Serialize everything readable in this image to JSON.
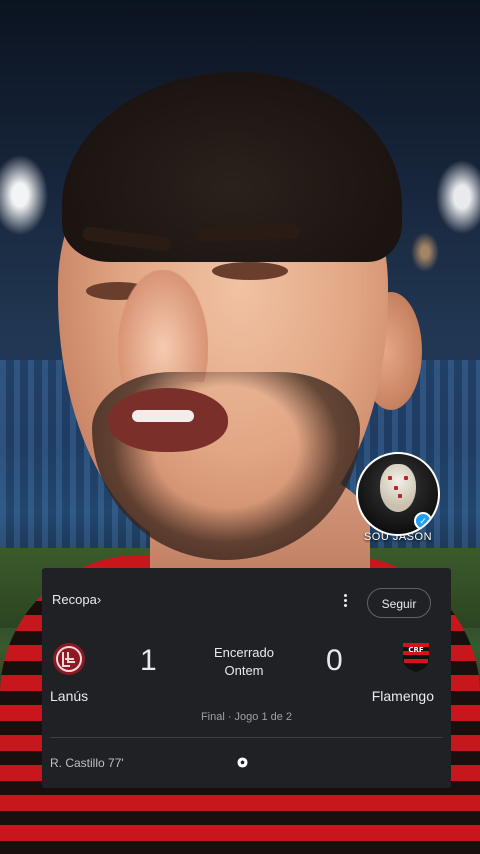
{
  "overlay": {
    "channel_name": "SOU JASON",
    "verified": true
  },
  "card": {
    "competition": "Recopa",
    "competition_chevron": "›",
    "follow_label": "Seguir",
    "status_line1": "Encerrado",
    "status_line2": "Ontem",
    "home_team": "Lanús",
    "home_score": "1",
    "away_team": "Flamengo",
    "away_score": "0",
    "round": "Final · Jogo 1 de 2",
    "scorer": "R. Castillo 77'"
  },
  "colors": {
    "card_bg": "#202124",
    "lanus_red": "#8b1a24",
    "flamengo_red": "#d6131c",
    "flamengo_black": "#111111"
  },
  "icons": {
    "more": "more-vert-icon",
    "ball": "soccer-ball-icon",
    "home_logo": "lanus-crest-icon",
    "away_logo": "flamengo-crest-icon"
  }
}
